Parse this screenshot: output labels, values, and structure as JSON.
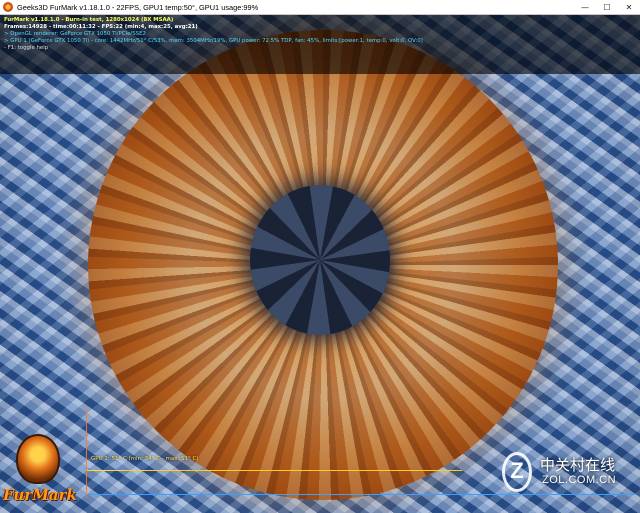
{
  "window": {
    "title": "Geeks3D FurMark v1.18.1.0 - 22FPS, GPU1 temp:50°, GPU1 usage:99%",
    "minimize_glyph": "—",
    "maximize_glyph": "☐",
    "close_glyph": "✕"
  },
  "osd": {
    "line1": "FurMark v1.18.1.0 - Burn-in test, 1280x1024 (8X MSAA)",
    "line2": "Frames:14928 - time:00:11:32 - FPS:22 (min:4, max:25, avg:21)",
    "line3": "> OpenGL renderer: GeForce GTX 1050 Ti/PCIe/SSE2",
    "line4": "> GPU 1 (GeForce GTX 1050 Ti) - core: 1442MHz/51° C/53%, mem: 3504MHz/19%, GPU power: 72.5% TDP, fan: 45%, limits:[power:1, temp:0, volt:0, OV:0]",
    "line5": "- F1: toggle help"
  },
  "graph": {
    "label": "GPU 1: 51° C (min: 34° C - max: 51° C)"
  },
  "logo": {
    "text": "FurMark",
    "icon": "furmark-logo-icon"
  },
  "watermark": {
    "mark": "Z",
    "cn": "中关村在线",
    "en": "ZOL.COM.CN"
  },
  "colors": {
    "osd_title": "#ffff55",
    "osd_info": "#55d7ff",
    "graph_line": "#ffcc22",
    "graph_axis": "#3aa0ff"
  }
}
